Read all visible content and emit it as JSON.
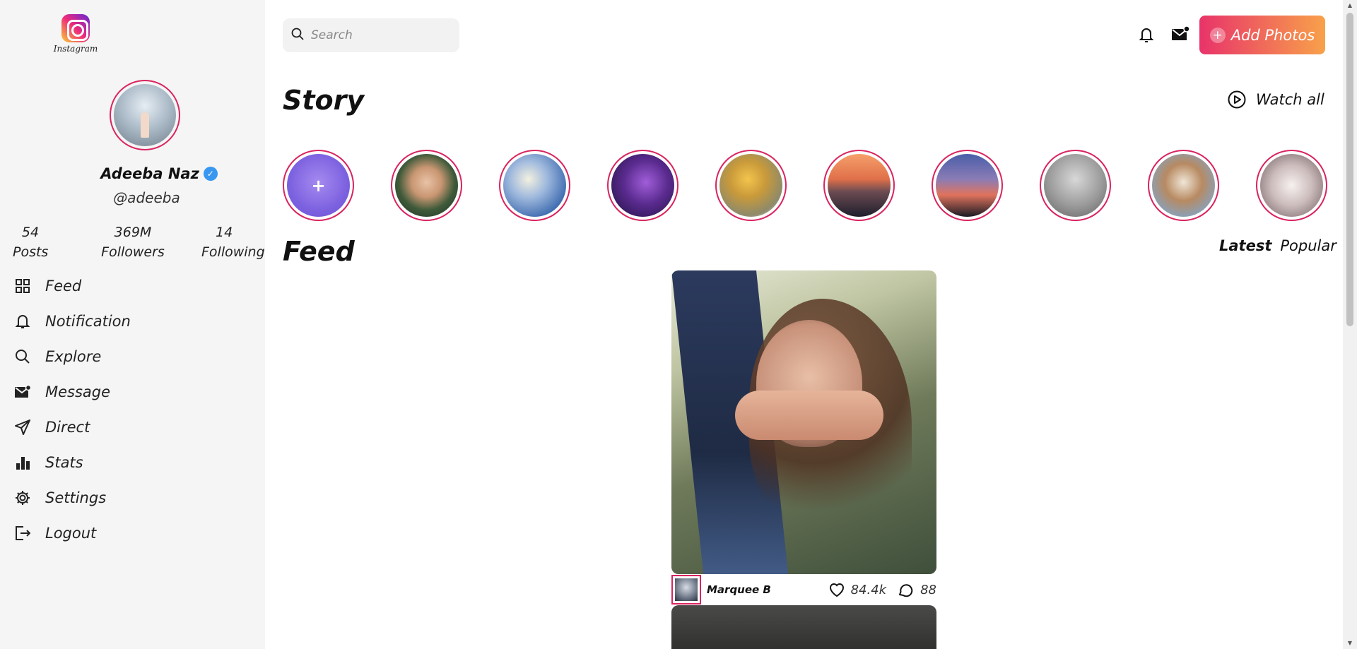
{
  "app": {
    "logo_text": "Instagram"
  },
  "profile": {
    "name": "Adeeba Naz",
    "verified_glyph": "✓",
    "handle": "@adeeba",
    "stats": [
      {
        "value": "54",
        "label": "Posts"
      },
      {
        "value": "369M",
        "label": "Followers"
      },
      {
        "value": "14",
        "label": "Following"
      }
    ]
  },
  "nav": {
    "items": [
      {
        "label": "Feed",
        "icon": "grid-icon"
      },
      {
        "label": "Notification",
        "icon": "bell-icon"
      },
      {
        "label": "Explore",
        "icon": "search-icon"
      },
      {
        "label": "Message",
        "icon": "mail-icon"
      },
      {
        "label": "Direct",
        "icon": "send-icon"
      },
      {
        "label": "Stats",
        "icon": "bar-chart-icon"
      },
      {
        "label": "Settings",
        "icon": "gear-icon"
      },
      {
        "label": "Logout",
        "icon": "logout-icon"
      }
    ]
  },
  "header": {
    "search_placeholder": "Search",
    "add_photos_label": "Add Photos",
    "add_icon_glyph": "+"
  },
  "story": {
    "title": "Story",
    "watch_all_label": "Watch all",
    "add_glyph": "+"
  },
  "feed": {
    "title": "Feed",
    "tabs": [
      "Latest",
      "Popular"
    ],
    "post": {
      "user": "Marquee B",
      "likes": "84.4k",
      "comments": "88"
    }
  },
  "colors": {
    "accent_ring": "#d9245f",
    "button_gradient_start": "#e8336a",
    "button_gradient_end": "#f8a14a",
    "sidebar_bg": "#f5f5f5",
    "verified": "#3897f0"
  }
}
